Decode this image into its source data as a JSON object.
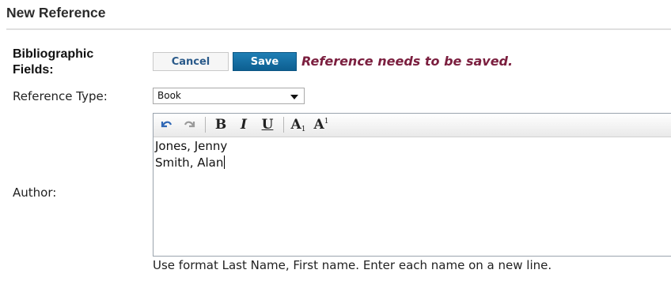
{
  "header": {
    "title": "New Reference"
  },
  "form": {
    "bibliographic_label_line1": "Bibliographic",
    "bibliographic_label_line2": "Fields:",
    "cancel_label": "Cancel",
    "save_label": "Save",
    "status_message": "Reference needs to be saved.",
    "reference_type_label": "Reference Type:",
    "reference_type_value": "Book",
    "author_label": "Author:",
    "author_lines": [
      "Jones, Jenny",
      "Smith, Alan"
    ],
    "author_help": "Use format Last Name, First name. Enter each name on a new line."
  },
  "editor_toolbar": {
    "bold": "B",
    "italic": "I",
    "underline": "U",
    "subscript_letter": "A",
    "subscript_mark": "1",
    "superscript_letter": "A",
    "superscript_mark": "1",
    "icons": [
      "undo-icon",
      "redo-icon"
    ]
  },
  "colors": {
    "save_button": "#0d5f91",
    "status_message": "#7b1f3f",
    "cancel_text": "#2a5a8a"
  }
}
